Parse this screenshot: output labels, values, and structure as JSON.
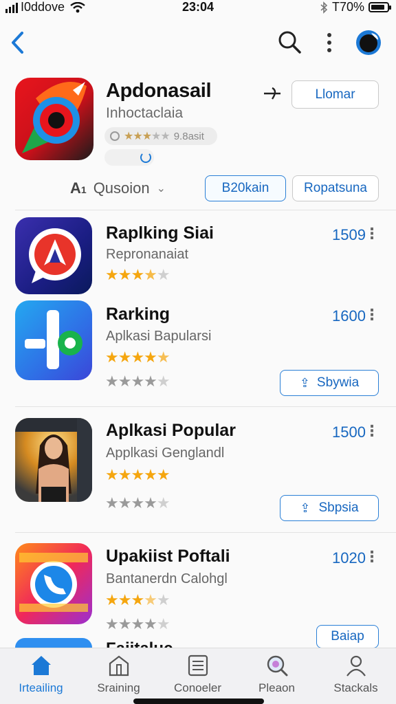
{
  "status_bar": {
    "carrier": "I0ddove",
    "time": "23:04",
    "battery": "T70%",
    "battery_level": 0.85
  },
  "featured": {
    "title": "Apdonasail",
    "subtitle": "Inhoctaclaia",
    "rating_text": "9.8asit",
    "primary_button": "Llomar",
    "filter_label": "Qusoion",
    "chip_1": "B20kain",
    "chip_2": "Ropatsuna"
  },
  "apps": [
    {
      "title": "Raplking Siai",
      "subtitle": "Repronanaiat",
      "count": "1509",
      "rating": 3.5
    },
    {
      "title": "Rarking",
      "subtitle": "Aplkasi Bapularsi",
      "count": "1600",
      "rating": 4.5,
      "rating2": 4,
      "action": "Sbywia"
    },
    {
      "title": "Aplkasi Popular",
      "subtitle": "Applkasi Genglandl",
      "count": "1500",
      "rating": 5,
      "rating2": 4,
      "action": "Sbpsia"
    },
    {
      "title": "Upakiist Poftali",
      "subtitle": "Bantanerdn Calohgl",
      "count": "1020",
      "rating": 3.5,
      "rating2": 4,
      "action": "Baiap"
    }
  ],
  "partial_next_title": "Faiitaluc",
  "tabs": [
    "Irteailing",
    "Sraining",
    "Conoeler",
    "Pleaon",
    "Stackals"
  ],
  "colors": {
    "accent": "#1c79d6",
    "star": "#f5a60f",
    "link": "#1767c0"
  }
}
